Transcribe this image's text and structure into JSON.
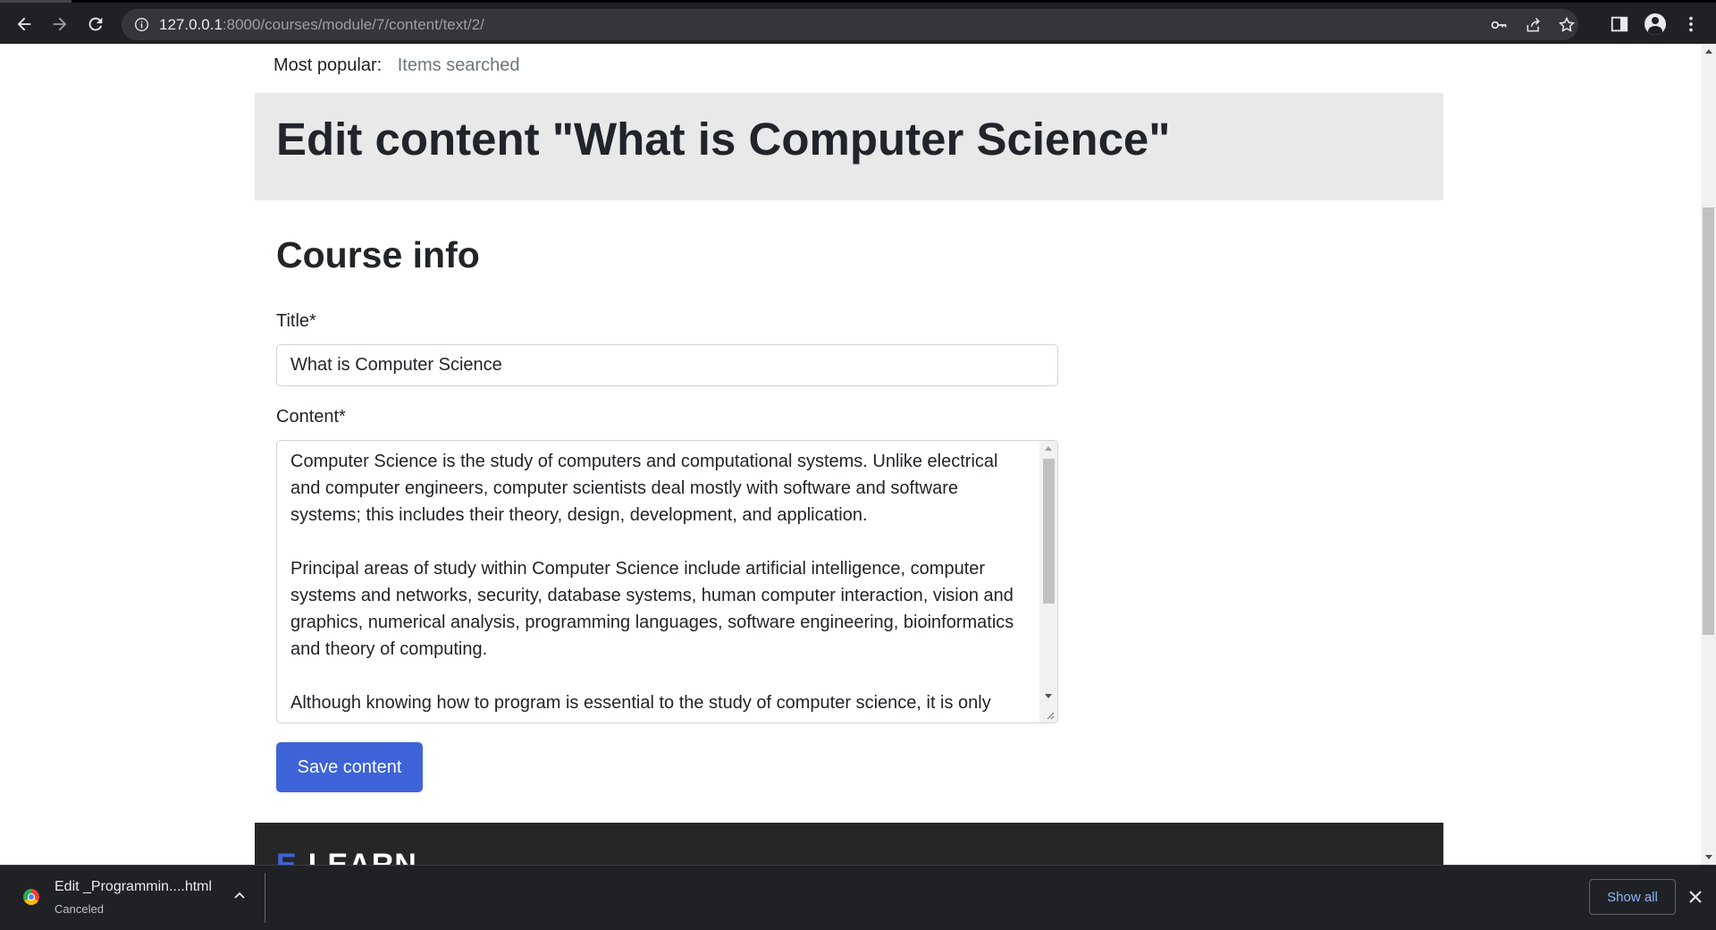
{
  "browser": {
    "url_host": "127.0.0.1",
    "url_path": ":8000/courses/module/7/content/text/2/"
  },
  "top_bar": {
    "label": "Most popular:",
    "value": "Items searched"
  },
  "page": {
    "title": "Edit content \"What is Computer Science\"",
    "section_title": "Course info"
  },
  "form": {
    "title_label": "Title*",
    "title_value": "What is Computer Science",
    "content_label": "Content*",
    "content_paragraphs": [
      "Computer Science is the study of computers and computational systems. Unlike electrical and computer engineers, computer scientists deal mostly with software and software systems; this includes their theory, design, development, and application.",
      "Principal areas of study within Computer Science include artificial intelligence, computer systems and networks, security, database systems, human computer interaction, vision and graphics, numerical analysis, programming languages, software engineering, bioinformatics and theory of computing.",
      "Although knowing how to program is essential to the study of computer science, it is only"
    ],
    "save_label": "Save content"
  },
  "footer": {
    "logo_mark": "E",
    "logo_text": "LEARN"
  },
  "downloads": {
    "file_name": "Edit _Programmin....html",
    "status": "Canceled",
    "show_all_label": "Show all"
  }
}
